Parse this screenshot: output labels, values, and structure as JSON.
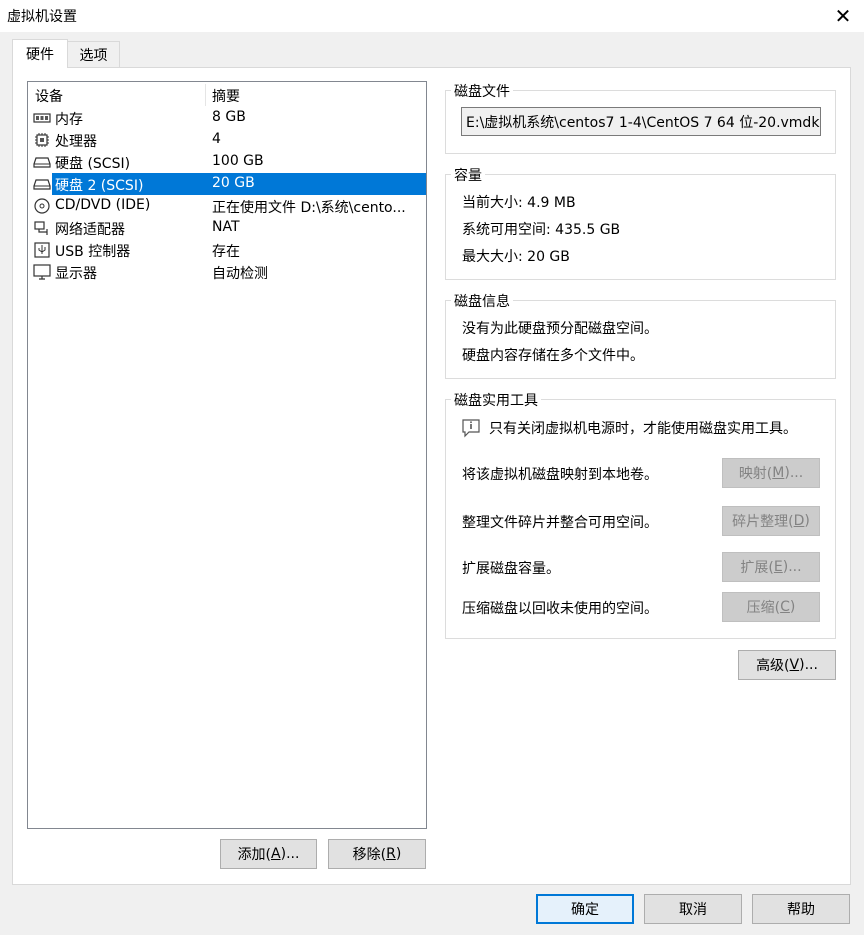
{
  "window": {
    "title": "虚拟机设置",
    "close_symbol": "✕"
  },
  "tabs": [
    {
      "label": "硬件",
      "active": true
    },
    {
      "label": "选项",
      "active": false
    }
  ],
  "device_list": {
    "columns": [
      "设备",
      "摘要"
    ],
    "rows": [
      {
        "name": "内存",
        "summary": "8 GB",
        "icon": "memory-icon"
      },
      {
        "name": "处理器",
        "summary": "4",
        "icon": "processor-icon"
      },
      {
        "name": "硬盘 (SCSI)",
        "summary": "100 GB",
        "icon": "hard-disk-icon"
      },
      {
        "name": "硬盘 2 (SCSI)",
        "summary": "20 GB",
        "icon": "hard-disk-icon",
        "selected": true
      },
      {
        "name": "CD/DVD (IDE)",
        "summary": "正在使用文件 D:\\系统\\cento...",
        "icon": "cd-dvd-icon"
      },
      {
        "name": "网络适配器",
        "summary": "NAT",
        "icon": "network-adapter-icon"
      },
      {
        "name": "USB 控制器",
        "summary": "存在",
        "icon": "usb-icon"
      },
      {
        "name": "显示器",
        "summary": "自动检测",
        "icon": "monitor-icon"
      }
    ],
    "add_button": {
      "prefix": "添加(",
      "key": "A",
      "suffix": ")..."
    },
    "remove_button": {
      "prefix": "移除(",
      "key": "R",
      "suffix": ")"
    }
  },
  "disk_file": {
    "label": "磁盘文件",
    "value": "E:\\虚拟机系统\\centos7 1-4\\CentOS 7 64 位-20.vmdk"
  },
  "capacity": {
    "label": "容量",
    "current_size": "当前大小: 4.9 MB",
    "system_free": "系统可用空间: 435.5 GB",
    "max_size": "最大大小: 20 GB"
  },
  "disk_info": {
    "label": "磁盘信息",
    "line1": "没有为此硬盘预分配磁盘空间。",
    "line2": "硬盘内容存储在多个文件中。"
  },
  "utilities": {
    "label": "磁盘实用工具",
    "notice": "只有关闭虚拟机电源时，才能使用磁盘实用工具。",
    "map_text": "将该虚拟机磁盘映射到本地卷。",
    "map_button": {
      "prefix": "映射(",
      "key": "M",
      "suffix": ")..."
    },
    "defrag_text": "整理文件碎片并整合可用空间。",
    "defrag_button": {
      "prefix": "碎片整理(",
      "key": "D",
      "suffix": ")"
    },
    "expand_text": "扩展磁盘容量。",
    "expand_button": {
      "prefix": "扩展(",
      "key": "E",
      "suffix": ")..."
    },
    "compact_text": "压缩磁盘以回收未使用的空间。",
    "compact_button": {
      "prefix": "压缩(",
      "key": "C",
      "suffix": ")"
    }
  },
  "advanced_button": {
    "prefix": "高级(",
    "key": "V",
    "suffix": ")..."
  },
  "footer": {
    "ok": "确定",
    "cancel": "取消",
    "help": "帮助"
  },
  "colors": {
    "selection": "#0078d7",
    "window_bg": "#f0f0f0"
  }
}
